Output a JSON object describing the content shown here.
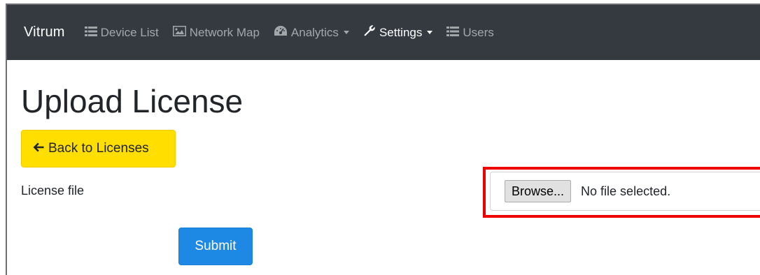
{
  "navbar": {
    "brand": "Vitrum",
    "items": [
      {
        "label": "Device List",
        "icon": "list-icon"
      },
      {
        "label": "Network Map",
        "icon": "image-icon"
      },
      {
        "label": "Analytics",
        "icon": "dashboard-icon",
        "dropdown": true
      },
      {
        "label": "Settings",
        "icon": "wrench-icon",
        "dropdown": true,
        "active": true
      },
      {
        "label": "Users",
        "icon": "list-icon"
      }
    ]
  },
  "page": {
    "title": "Upload License",
    "back_label": "Back to Licenses",
    "field_label": "License file",
    "browse_label": "Browse...",
    "file_status": "No file selected.",
    "submit_label": "Submit"
  },
  "colors": {
    "navbar_bg": "#343a40",
    "back_button": "#ffde00",
    "submit_button": "#1e88e5",
    "highlight": "#ee0000"
  }
}
